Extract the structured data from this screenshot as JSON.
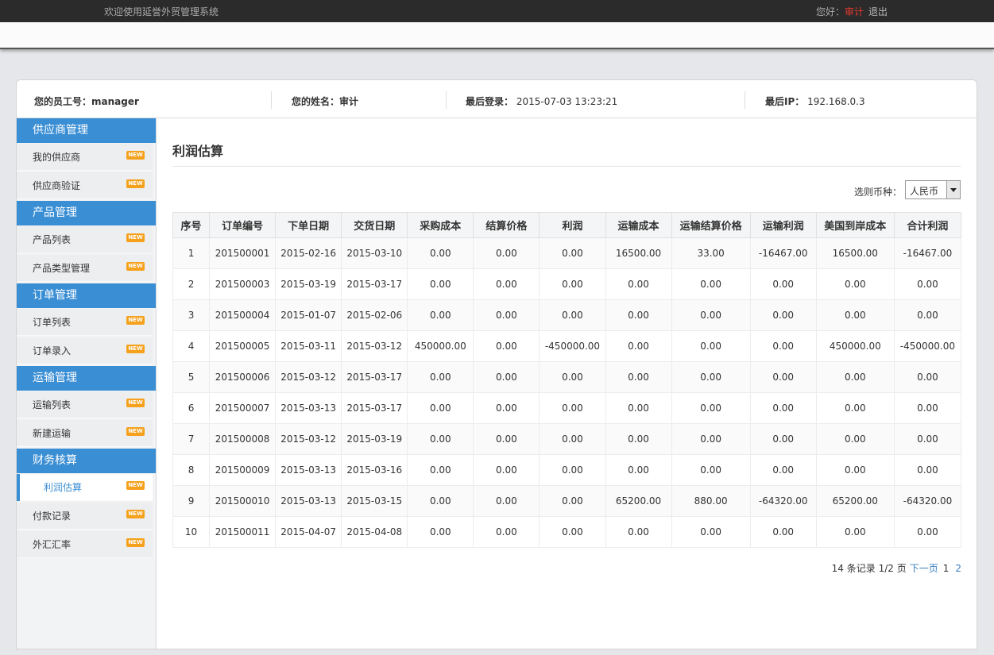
{
  "topbar": {
    "welcome": "欢迎使用延誉外贸管理系统",
    "greeting": "您好：",
    "user": "审计",
    "logout": "退出"
  },
  "info": {
    "emp_label": "您的员工号：",
    "emp_value": "manager",
    "name_label": "您的姓名：",
    "name_value": "审计",
    "login_label": "最后登录：",
    "login_value": "2015-07-03 13:23:21",
    "ip_label": "最后IP：",
    "ip_value": "192.168.0.3"
  },
  "sidebar": {
    "badge": "NEW",
    "groups": [
      {
        "title": "供应商管理",
        "items": [
          "我的供应商",
          "供应商验证"
        ]
      },
      {
        "title": "产品管理",
        "items": [
          "产品列表",
          "产品类型管理"
        ]
      },
      {
        "title": "订单管理",
        "items": [
          "订单列表",
          "订单录入"
        ]
      },
      {
        "title": "运输管理",
        "items": [
          "运输列表",
          "新建运输"
        ]
      },
      {
        "title": "财务核算",
        "items": [
          "利润估算",
          "付款记录",
          "外汇汇率"
        ]
      }
    ]
  },
  "main": {
    "title": "利润估算",
    "currency_label": "选则币种：",
    "currency_value": "人民币",
    "columns": [
      "序号",
      "订单编号",
      "下单日期",
      "交货日期",
      "采购成本",
      "结算价格",
      "利润",
      "运输成本",
      "运输结算价格",
      "运输利润",
      "美国到岸成本",
      "合计利润"
    ],
    "rows": [
      [
        "1",
        "201500001",
        "2015-02-16",
        "2015-03-10",
        "0.00",
        "0.00",
        "0.00",
        "16500.00",
        "33.00",
        "-16467.00",
        "16500.00",
        "-16467.00"
      ],
      [
        "2",
        "201500003",
        "2015-03-19",
        "2015-03-17",
        "0.00",
        "0.00",
        "0.00",
        "0.00",
        "0.00",
        "0.00",
        "0.00",
        "0.00"
      ],
      [
        "3",
        "201500004",
        "2015-01-07",
        "2015-02-06",
        "0.00",
        "0.00",
        "0.00",
        "0.00",
        "0.00",
        "0.00",
        "0.00",
        "0.00"
      ],
      [
        "4",
        "201500005",
        "2015-03-11",
        "2015-03-12",
        "450000.00",
        "0.00",
        "-450000.00",
        "0.00",
        "0.00",
        "0.00",
        "450000.00",
        "-450000.00"
      ],
      [
        "5",
        "201500006",
        "2015-03-12",
        "2015-03-17",
        "0.00",
        "0.00",
        "0.00",
        "0.00",
        "0.00",
        "0.00",
        "0.00",
        "0.00"
      ],
      [
        "6",
        "201500007",
        "2015-03-13",
        "2015-03-17",
        "0.00",
        "0.00",
        "0.00",
        "0.00",
        "0.00",
        "0.00",
        "0.00",
        "0.00"
      ],
      [
        "7",
        "201500008",
        "2015-03-12",
        "2015-03-19",
        "0.00",
        "0.00",
        "0.00",
        "0.00",
        "0.00",
        "0.00",
        "0.00",
        "0.00"
      ],
      [
        "8",
        "201500009",
        "2015-03-13",
        "2015-03-16",
        "0.00",
        "0.00",
        "0.00",
        "0.00",
        "0.00",
        "0.00",
        "0.00",
        "0.00"
      ],
      [
        "9",
        "201500010",
        "2015-03-13",
        "2015-03-15",
        "0.00",
        "0.00",
        "0.00",
        "65200.00",
        "880.00",
        "-64320.00",
        "65200.00",
        "-64320.00"
      ],
      [
        "10",
        "201500011",
        "2015-04-07",
        "2015-04-08",
        "0.00",
        "0.00",
        "0.00",
        "0.00",
        "0.00",
        "0.00",
        "0.00",
        "0.00"
      ]
    ],
    "pager": {
      "summary": "14 条记录 1/2 页",
      "next": "下一页",
      "page1": "1",
      "page2": "2"
    }
  }
}
